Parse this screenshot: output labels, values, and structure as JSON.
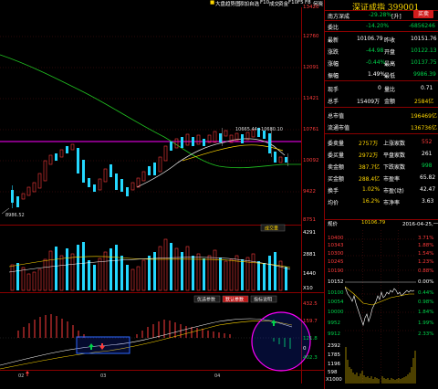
{
  "topbar": {
    "items": [
      "■",
      "大盘趋势图",
      "添加自选",
      "F10",
      "成交",
      "资金",
      "F10",
      "F5",
      "F8",
      "何晓"
    ],
    "colors": {
      "accent": "#ffd700"
    }
  },
  "price_axis": {
    "labels": [
      "13420",
      "12760",
      "12091",
      "11421",
      "10761",
      "10092",
      "9422",
      "8751"
    ]
  },
  "volume_axis": {
    "labels": [
      "4291",
      "2881",
      "1440",
      "X10"
    ]
  },
  "macd_axis": {
    "labels": [
      "432.5",
      "159.7",
      "121.8",
      "0",
      "402.3"
    ]
  },
  "chart_labels": {
    "high_tip": "10665.44+10680.10",
    "low_tip": "8986.52",
    "volume_tab": "成交量",
    "tabs": [
      "优选参数",
      "默认参数",
      "指标说明"
    ],
    "month_labels": [
      "02",
      "03",
      "04"
    ]
  },
  "panel": {
    "title": "深证成指 399001",
    "buy_label": "买卖",
    "rows": [
      {
        "l": "南方深成",
        "v": "-29.28%",
        "r": "[升]",
        "vclass": "green"
      },
      {
        "l": "委比",
        "v": "-14.20%",
        "r": "-6856246",
        "vclass": "green",
        "rclass": "green"
      },
      {
        "l": "最新",
        "v": "10106.79",
        "m": "昨收",
        "r": "10151.76",
        "vclass": "white",
        "rclass": "white"
      },
      {
        "l": "涨跌",
        "v": "-44.98",
        "m": "开盘",
        "r": "10122.13",
        "vclass": "green",
        "rclass": "green"
      },
      {
        "l": "涨幅",
        "v": "-0.44%",
        "m": "最高",
        "r": "10137.75",
        "vclass": "green",
        "rclass": "green"
      },
      {
        "l": "振幅",
        "v": "1.49%",
        "m": "最低",
        "r": "9986.39",
        "vclass": "white",
        "rclass": "green"
      },
      {
        "l": "现手",
        "v": "0",
        "m": "量比",
        "r": "0.71",
        "vclass": "white",
        "rclass": "white"
      },
      {
        "l": "总手",
        "v": "15409万",
        "m": "金额",
        "r": "2584亿",
        "vclass": "white",
        "rclass": "yellow"
      }
    ],
    "rows2": [
      {
        "l": "总市值",
        "r": "196469亿",
        "rclass": "yellow"
      },
      {
        "l": "流通市值",
        "r": "136736亿",
        "rclass": "yellow"
      }
    ],
    "rows3": [
      {
        "l": "委卖量",
        "v": "2757万",
        "m": "上涨家数",
        "r": "552",
        "vclass": "yellow",
        "rclass": "red"
      },
      {
        "l": "委买量",
        "v": "2972万",
        "m": "平盘家数",
        "r": "261",
        "vclass": "yellow",
        "rclass": "white"
      },
      {
        "l": "卖金额",
        "v": "387.7亿",
        "m": "下跌家数",
        "r": "998",
        "vclass": "yellow",
        "rclass": "green"
      },
      {
        "l": "买金额",
        "v": "288.4亿",
        "m": "市盈率",
        "r": "65.82",
        "vclass": "yellow",
        "rclass": "white"
      },
      {
        "l": "换手",
        "v": "1.02%",
        "m": "市盈(动)",
        "r": "42.47",
        "vclass": "yellow",
        "rclass": "white"
      },
      {
        "l": "均价",
        "v": "16.2%",
        "m": "市净率",
        "r": "3.63",
        "vclass": "yellow",
        "rclass": "white"
      }
    ],
    "mini_header": {
      "left": "规价",
      "mid": "10106.79",
      "right": "2016-04-25,一"
    },
    "mini_ticks": [
      {
        "l": "10400",
        "r": "3.71%",
        "lclass": "red",
        "rclass": "red"
      },
      {
        "l": "10343",
        "r": "1.88%",
        "lclass": "red",
        "rclass": "red"
      },
      {
        "l": "10300",
        "r": "1.54%",
        "lclass": "red",
        "rclass": "red"
      },
      {
        "l": "10245",
        "r": "1.23%",
        "lclass": "red",
        "rclass": "red"
      },
      {
        "l": "10190",
        "r": "0.88%",
        "lclass": "red",
        "rclass": "red"
      },
      {
        "l": "10152",
        "r": "0.00%",
        "lclass": "white",
        "rclass": "white"
      },
      {
        "l": "10100",
        "r": "0.44%",
        "lclass": "green",
        "rclass": "green"
      },
      {
        "l": "10054",
        "r": "0.98%",
        "lclass": "green",
        "rclass": "green"
      },
      {
        "l": "10000",
        "r": "1.84%",
        "lclass": "green",
        "rclass": "green"
      },
      {
        "l": "9952",
        "r": "1.99%",
        "lclass": "green",
        "rclass": "green"
      },
      {
        "l": "9912",
        "r": "2.33%",
        "lclass": "green",
        "rclass": "green"
      }
    ],
    "mini_vol": [
      "2392",
      "1785",
      "1196",
      "598",
      "X1000"
    ],
    "mini_times": [
      "9:30",
      "10:30",
      "13:00",
      "14:00",
      "15:00"
    ]
  }
}
